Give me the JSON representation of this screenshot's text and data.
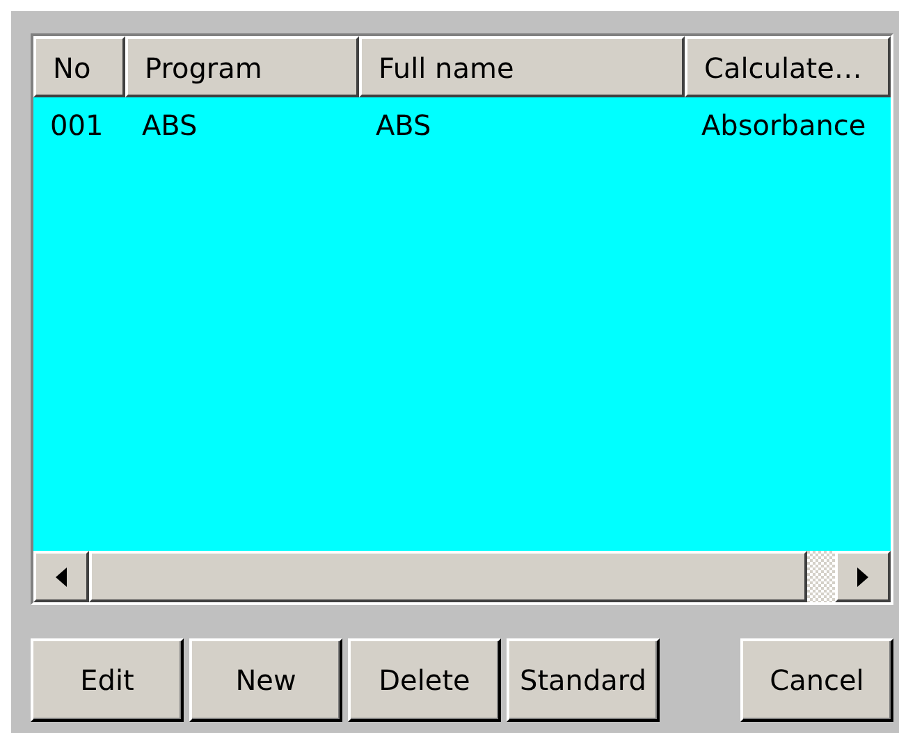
{
  "table": {
    "columns": [
      "No",
      "Program",
      "Full name",
      "Calculate…"
    ],
    "rows": [
      [
        "001",
        "ABS",
        "ABS",
        "Absorbance"
      ]
    ]
  },
  "buttons": [
    {
      "label": "Edit",
      "kind": "action"
    },
    {
      "label": "New",
      "kind": "action"
    },
    {
      "label": "Delete",
      "kind": "action"
    },
    {
      "label": "Standard",
      "kind": "action"
    },
    {
      "label": "Cancel",
      "kind": "dismiss"
    }
  ]
}
